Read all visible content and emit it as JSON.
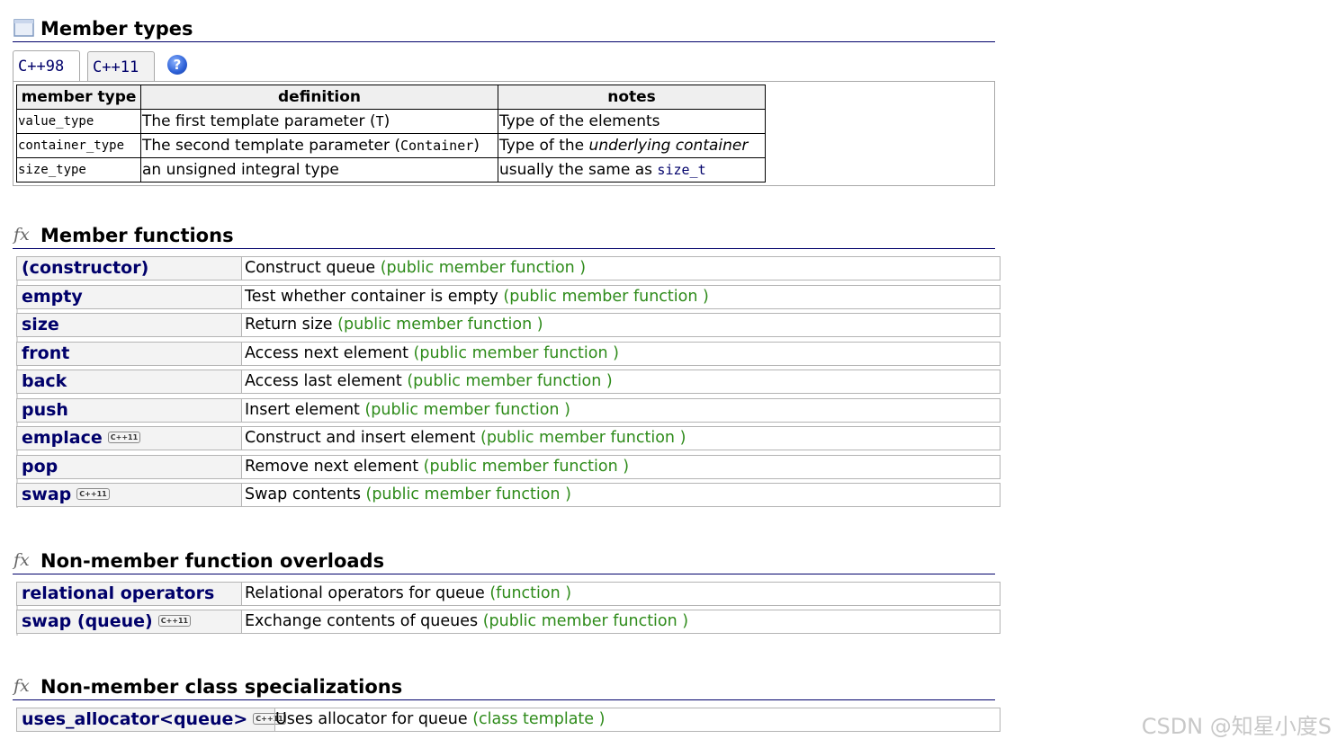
{
  "member_types": {
    "title": "Member types",
    "icon": "table-icon",
    "tabs": [
      "C++98",
      "C++11"
    ],
    "help_symbol": "?",
    "headers": [
      "member type",
      "definition",
      "notes"
    ],
    "rows": [
      {
        "type": "value_type",
        "def_text": "The first template parameter (",
        "def_code": "T",
        "def_end": ")",
        "notes_pre": "Type of the elements",
        "notes_em": "",
        "notes_code": ""
      },
      {
        "type": "container_type",
        "def_text": "The second template parameter (",
        "def_code": "Container",
        "def_end": ")",
        "notes_pre": "Type of the ",
        "notes_em": "underlying container",
        "notes_code": ""
      },
      {
        "type": "size_type",
        "def_text": "an unsigned integral type",
        "def_code": "",
        "def_end": "",
        "notes_pre": "usually the same as ",
        "notes_em": "",
        "notes_code": "size_t"
      }
    ]
  },
  "member_functions": {
    "title": "Member functions",
    "fx": "fx",
    "items": [
      {
        "name": "(constructor)",
        "desc": "Construct queue ",
        "kind": "(public member function )",
        "badge": ""
      },
      {
        "name": "empty",
        "desc": "Test whether container is empty ",
        "kind": "(public member function )",
        "badge": ""
      },
      {
        "name": "size",
        "desc": "Return size ",
        "kind": "(public member function )",
        "badge": ""
      },
      {
        "name": "front",
        "desc": "Access next element ",
        "kind": "(public member function )",
        "badge": ""
      },
      {
        "name": "back",
        "desc": "Access last element ",
        "kind": "(public member function )",
        "badge": ""
      },
      {
        "name": "push",
        "desc": "Insert element ",
        "kind": "(public member function )",
        "badge": ""
      },
      {
        "name": "emplace",
        "desc": "Construct and insert element ",
        "kind": "(public member function )",
        "badge": "C++11"
      },
      {
        "name": "pop",
        "desc": "Remove next element ",
        "kind": "(public member function )",
        "badge": ""
      },
      {
        "name": "swap",
        "desc": "Swap contents ",
        "kind": "(public member function )",
        "badge": "C++11"
      }
    ]
  },
  "non_member_overloads": {
    "title": "Non-member function overloads",
    "fx": "fx",
    "items": [
      {
        "name": "relational operators",
        "desc": "Relational operators for queue ",
        "kind": "(function )",
        "badge": ""
      },
      {
        "name": "swap (queue)",
        "desc": "Exchange contents of queues ",
        "kind": "(public member function )",
        "badge": "C++11"
      }
    ]
  },
  "non_member_specializations": {
    "title": "Non-member class specializations",
    "fx": "fx",
    "items": [
      {
        "name": "uses_allocator<queue>",
        "desc": "Uses allocator for queue ",
        "kind": "(class template )",
        "badge": "C++11"
      }
    ]
  },
  "watermark": "CSDN @知星小度S",
  "colors": {
    "link": "#00006a",
    "kind": "#2e8b1a",
    "header_bg": "#efefef",
    "name_bg": "#f3f3f3"
  }
}
